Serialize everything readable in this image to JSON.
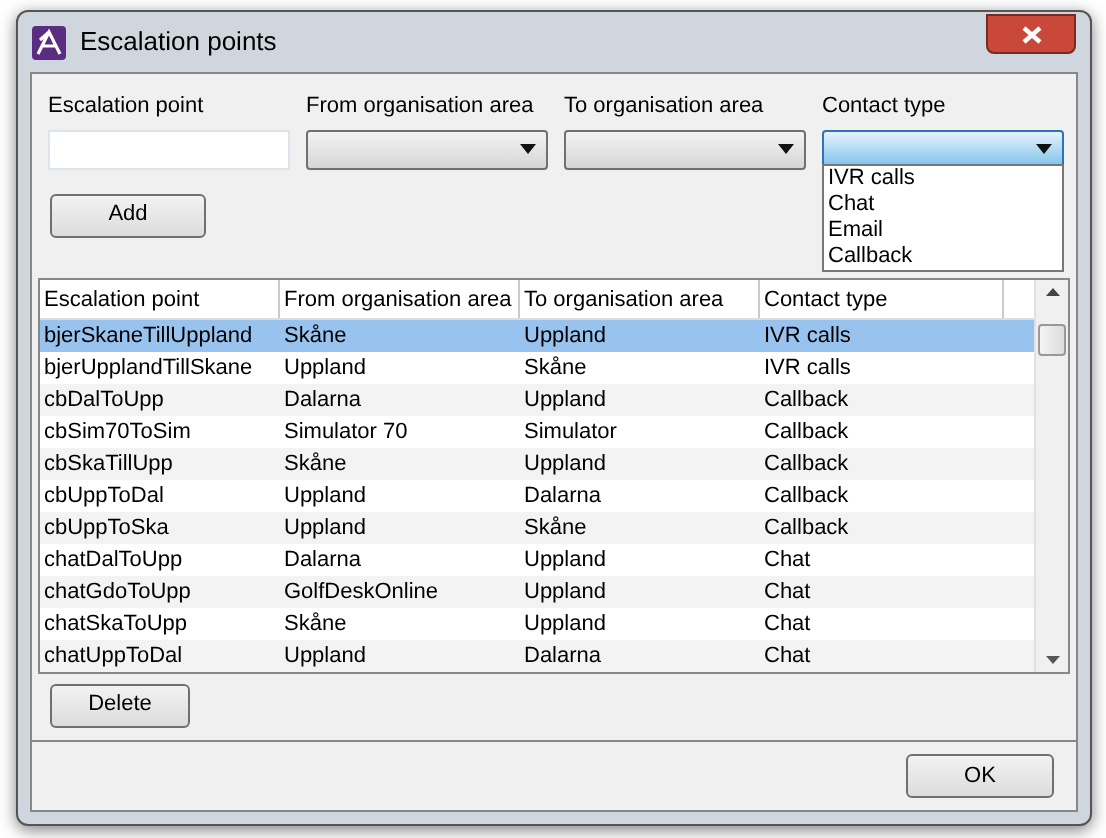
{
  "window": {
    "title": "Escalation points"
  },
  "filters": [
    {
      "label": "Escalation point",
      "kind": "text"
    },
    {
      "label": "From organisation area",
      "kind": "combo",
      "open": false
    },
    {
      "label": "To organisation area",
      "kind": "combo",
      "open": false
    },
    {
      "label": "Contact type",
      "kind": "combo",
      "open": true,
      "options": [
        "IVR calls",
        "Chat",
        "Email",
        "Callback"
      ]
    }
  ],
  "add_button": "Add",
  "table": {
    "columns": [
      "Escalation point",
      "From organisation area",
      "To organisation area",
      "Contact type"
    ],
    "rows": [
      {
        "cells": [
          "bjerSkaneTillUppland",
          "Skåne",
          "Uppland",
          "IVR calls"
        ],
        "selected": true
      },
      {
        "cells": [
          "bjerUpplandTillSkane",
          "Uppland",
          "Skåne",
          "IVR calls"
        ],
        "selected": false
      },
      {
        "cells": [
          "cbDalToUpp",
          "Dalarna",
          "Uppland",
          "Callback"
        ],
        "selected": false
      },
      {
        "cells": [
          "cbSim70ToSim",
          "Simulator 70",
          "Simulator",
          "Callback"
        ],
        "selected": false
      },
      {
        "cells": [
          "cbSkaTillUpp",
          "Skåne",
          "Uppland",
          "Callback"
        ],
        "selected": false
      },
      {
        "cells": [
          "cbUppToDal",
          "Uppland",
          "Dalarna",
          "Callback"
        ],
        "selected": false
      },
      {
        "cells": [
          "cbUppToSka",
          "Uppland",
          "Skåne",
          "Callback"
        ],
        "selected": false
      },
      {
        "cells": [
          "chatDalToUpp",
          "Dalarna",
          "Uppland",
          "Chat"
        ],
        "selected": false
      },
      {
        "cells": [
          "chatGdoToUpp",
          "GolfDeskOnline",
          "Uppland",
          "Chat"
        ],
        "selected": false
      },
      {
        "cells": [
          "chatSkaToUpp",
          "Skåne",
          "Uppland",
          "Chat"
        ],
        "selected": false
      },
      {
        "cells": [
          "chatUppToDal",
          "Uppland",
          "Dalarna",
          "Chat"
        ],
        "selected": false
      }
    ]
  },
  "delete_button": "Delete",
  "ok_button": "OK"
}
